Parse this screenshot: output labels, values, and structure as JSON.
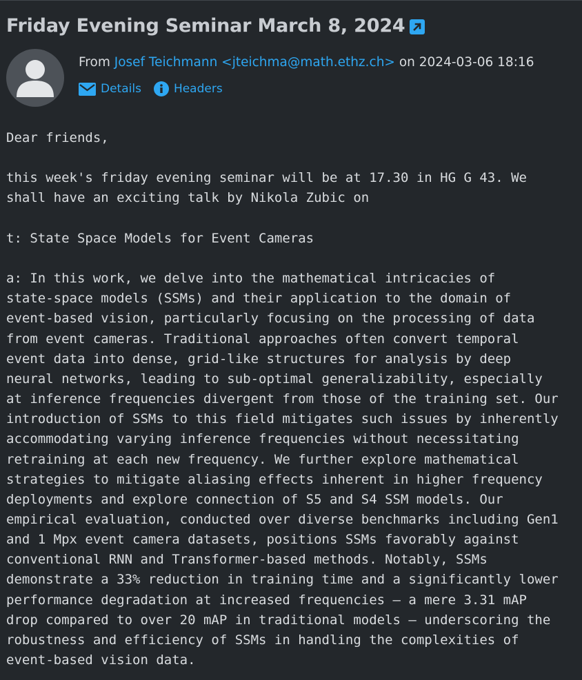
{
  "message": {
    "subject": "Friday Evening Seminar March 8, 2024",
    "from_label": "From",
    "sender": "Josef Teichmann <jteichma@math.ethz.ch>",
    "date_label": "on",
    "date": "2024-03-06 18:16"
  },
  "actions": {
    "details_label": "Details",
    "headers_label": "Headers"
  },
  "body": [
    "Dear friends,",
    "",
    "this week's friday evening seminar will be at 17.30 in HG G 43. We",
    "shall have an exciting talk by Nikola Zubic on",
    "",
    "t: State Space Models for Event Cameras",
    "",
    "a: In this work, we delve into the mathematical intricacies of",
    "state-space models (SSMs) and their application to the domain of",
    "event-based vision, particularly focusing on the processing of data",
    "from event cameras. Traditional approaches often convert temporal",
    "event data into dense, grid-like structures for analysis by deep",
    "neural networks, leading to sub-optimal generalizability, especially",
    "at inference frequencies divergent from those of the training set. Our",
    "introduction of SSMs to this field mitigates such issues by inherently",
    "accommodating varying inference frequencies without necessitating",
    "retraining at each new frequency. We further explore mathematical",
    "strategies to mitigate aliasing effects inherent in higher frequency",
    "deployments and explore connection of S5 and S4 SSM models. Our",
    "empirical evaluation, conducted over diverse benchmarks including Gen1",
    "and 1 Mpx event camera datasets, positions SSMs favorably against",
    "conventional RNN and Transformer-based methods. Notably, SSMs",
    "demonstrate a 33% reduction in training time and a significantly lower",
    "performance degradation at increased frequencies — a mere 3.31 mAP",
    "drop compared to over 20 mAP in traditional models — underscoring the",
    "robustness and efficiency of SSMs in handling the complexities of",
    "event-based vision data."
  ],
  "colors": {
    "background": "#23272b",
    "link": "#2ea7f2",
    "text": "#d9dcdf"
  },
  "icons": {
    "external_link": "external-link-icon",
    "details": "envelope-icon",
    "headers": "info-circle-icon",
    "avatar": "user-avatar-icon"
  }
}
